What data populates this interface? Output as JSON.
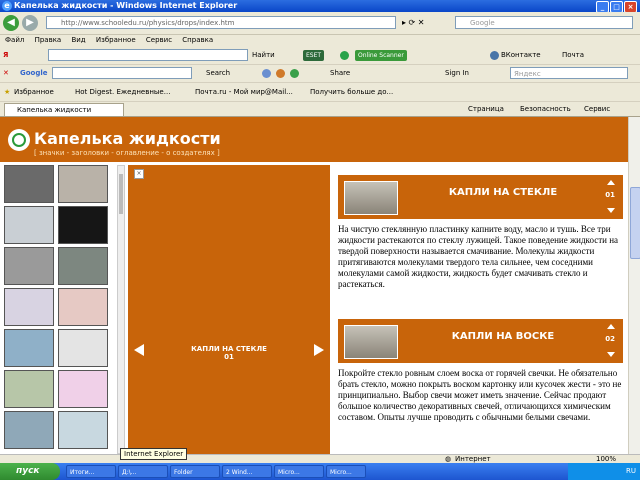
{
  "window": {
    "title": "Капелька жидкости - Windows Internet Explorer",
    "address": "http://www.schooledu.ru/physics/drops/index.htm",
    "search_placeholder": "Google"
  },
  "menu": [
    "Файл",
    "Правка",
    "Вид",
    "Избранное",
    "Сервис",
    "Справка"
  ],
  "yandex_toolbar": {
    "find_label": "Найти",
    "eset_label": "ESET",
    "online_scanner_label": "Online Scanner",
    "vk_label": "ВКонтакте",
    "mail_label": "Почта"
  },
  "google_toolbar": {
    "search_label": "Search",
    "share_label": "Share",
    "signin_label": "Sign In",
    "yandex_field": "Яндекс"
  },
  "favorites_bar": {
    "favorites_label": "Избранное",
    "links": [
      "Hot Digest. Ежедневные...",
      "Почта.ru - Мой мир@Mail...",
      "Получить больше до..."
    ]
  },
  "tab": {
    "label": "Капелька жидкости",
    "page_menu": "Страница",
    "safety_menu": "Безопасность",
    "tools_menu": "Сервис"
  },
  "site": {
    "title": "Капелька жидкости",
    "nav": "[ значки - заголовки - оглавление - о создателях ]"
  },
  "center_panel": {
    "caption": "КАПЛИ НА СТЕКЛЕ",
    "number": "01"
  },
  "cards": [
    {
      "title": "КАПЛИ НА СТЕКЛЕ",
      "number": "01",
      "text": "На чистую стеклянную пластинку капните воду, масло и тушь. Все три жидкости растекаются по стеклу лужицей. Такое поведение жидкости на твердой поверхности называется смачивание. Молекулы жидкости притягиваются молекулами твердого тела сильнее, чем соседними молекулами самой жидкости, жидкость будет смачивать стекло и растекаться."
    },
    {
      "title": "КАПЛИ НА ВОСКЕ",
      "number": "02",
      "text": "Покройте стекло ровным слоем воска от горячей свечки. Не обязательно брать стекло, можно покрыть воском картонку или кусочек жести - это не принципиально. Выбор свечи может иметь значение. Сейчас продают большое количество декоративных свечей, отличающихся химическим составом. Опыты лучше проводить с обычными белыми свечами."
    }
  ],
  "status_bar": {
    "internet_label": "Интернет",
    "zoom": "100%"
  },
  "taskbar": {
    "start_label": "пуск",
    "tasks": [
      "Итоги...",
      "Д:\\...",
      "Folder",
      "2 Wind...",
      "Micro...",
      "Micro..."
    ],
    "tooltip": "Internet Explorer",
    "clock": "RU"
  },
  "colors": {
    "accent": "#c8640a",
    "titlebar": "#0a46c8",
    "taskbar": "#1d55d0"
  }
}
